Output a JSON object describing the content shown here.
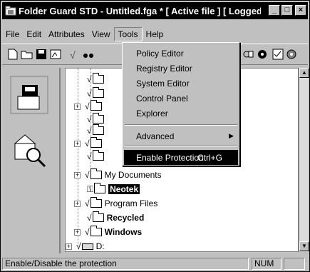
{
  "window": {
    "title": "Folder Guard STD - Untitled.fga * [ Active file ] [ Logged on a...",
    "min_label": "_",
    "max_label": "□",
    "close_label": "×"
  },
  "menubar": {
    "items": [
      "File",
      "Edit",
      "Attributes",
      "View",
      "Tools",
      "Help"
    ]
  },
  "tools_menu": {
    "items": [
      {
        "label": "Policy Editor"
      },
      {
        "label": "Registry Editor"
      },
      {
        "label": "System Editor"
      },
      {
        "label": "Control Panel"
      },
      {
        "label": "Explorer"
      },
      {
        "label": "Advanced",
        "submenu_arrow": "▶"
      },
      {
        "label": "Enable Protection",
        "shortcut": "Ctrl+G"
      }
    ]
  },
  "tree": {
    "items": [
      {
        "label": "My Documents",
        "style": "normal"
      },
      {
        "label": "Neotek",
        "style": "selected"
      },
      {
        "label": "Program Files",
        "style": "normal"
      },
      {
        "label": "Recycled",
        "style": "bold"
      },
      {
        "label": "Windows",
        "style": "bold"
      },
      {
        "label": "D:",
        "style": "drive"
      }
    ],
    "check_glyph": "√",
    "expand_glyph": "+"
  },
  "statusbar": {
    "message": "Enable/Disable the protection",
    "num": "NUM"
  },
  "icons": {
    "app": "folder-guard-icon",
    "new": "new-file-icon",
    "open": "open-folder-icon",
    "save": "save-disk-icon",
    "check": "check-icon",
    "find": "binoculars-icon"
  }
}
